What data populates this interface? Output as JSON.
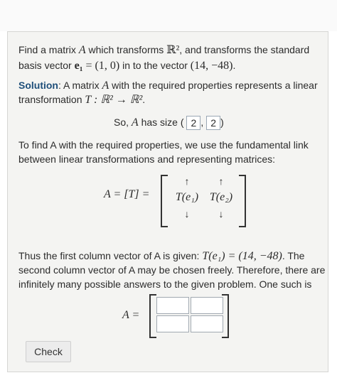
{
  "problem": {
    "line1_prefix": "Find a matrix ",
    "line1_var": "A",
    "line1_mid": " which transforms ",
    "line1_space": "ℝ²",
    "line1_suffix": ", and transforms the standard",
    "line2_prefix": "basis vector ",
    "line2_vec": "e₁",
    "line2_eq": " = (1, 0)",
    "line2_mid": " in to the vector ",
    "line2_target": "(14, −48)",
    "line2_end": "."
  },
  "solution": {
    "label": "Solution",
    "line1": ": A matrix ",
    "line1_var": "A",
    "line1_suffix": " with the required properties represents a linear",
    "line2_prefix": "transformation ",
    "line2_map": "T : ℝ² → ℝ²",
    "line2_end": ".",
    "size_prefix": "So, ",
    "size_var": "A",
    "size_mid": " has size (",
    "size_rows": "2",
    "size_sep": ",",
    "size_cols": "2",
    "size_end": ")"
  },
  "explanation": {
    "line1": "To find A with the required properties, we use the fundamental link",
    "line2": "between linear transformations and representing matrices:",
    "eq_lhs": "A = [T] =",
    "col1": "T(e₁)",
    "col2": "T(e₂)",
    "up_arrow": "↑",
    "down_arrow": "↓"
  },
  "answer_text": {
    "line1_prefix": "Thus the first column vector of A is given: ",
    "line1_eq": "T(e₁) = (14, −48)",
    "line1_suffix": ". The",
    "line2": "second column vector of A may be chosen freely. Therefore, there are",
    "line3": "infinitely many possible answers to the given problem. One such is",
    "matrix_lhs": "A ="
  },
  "check_button": "Check"
}
